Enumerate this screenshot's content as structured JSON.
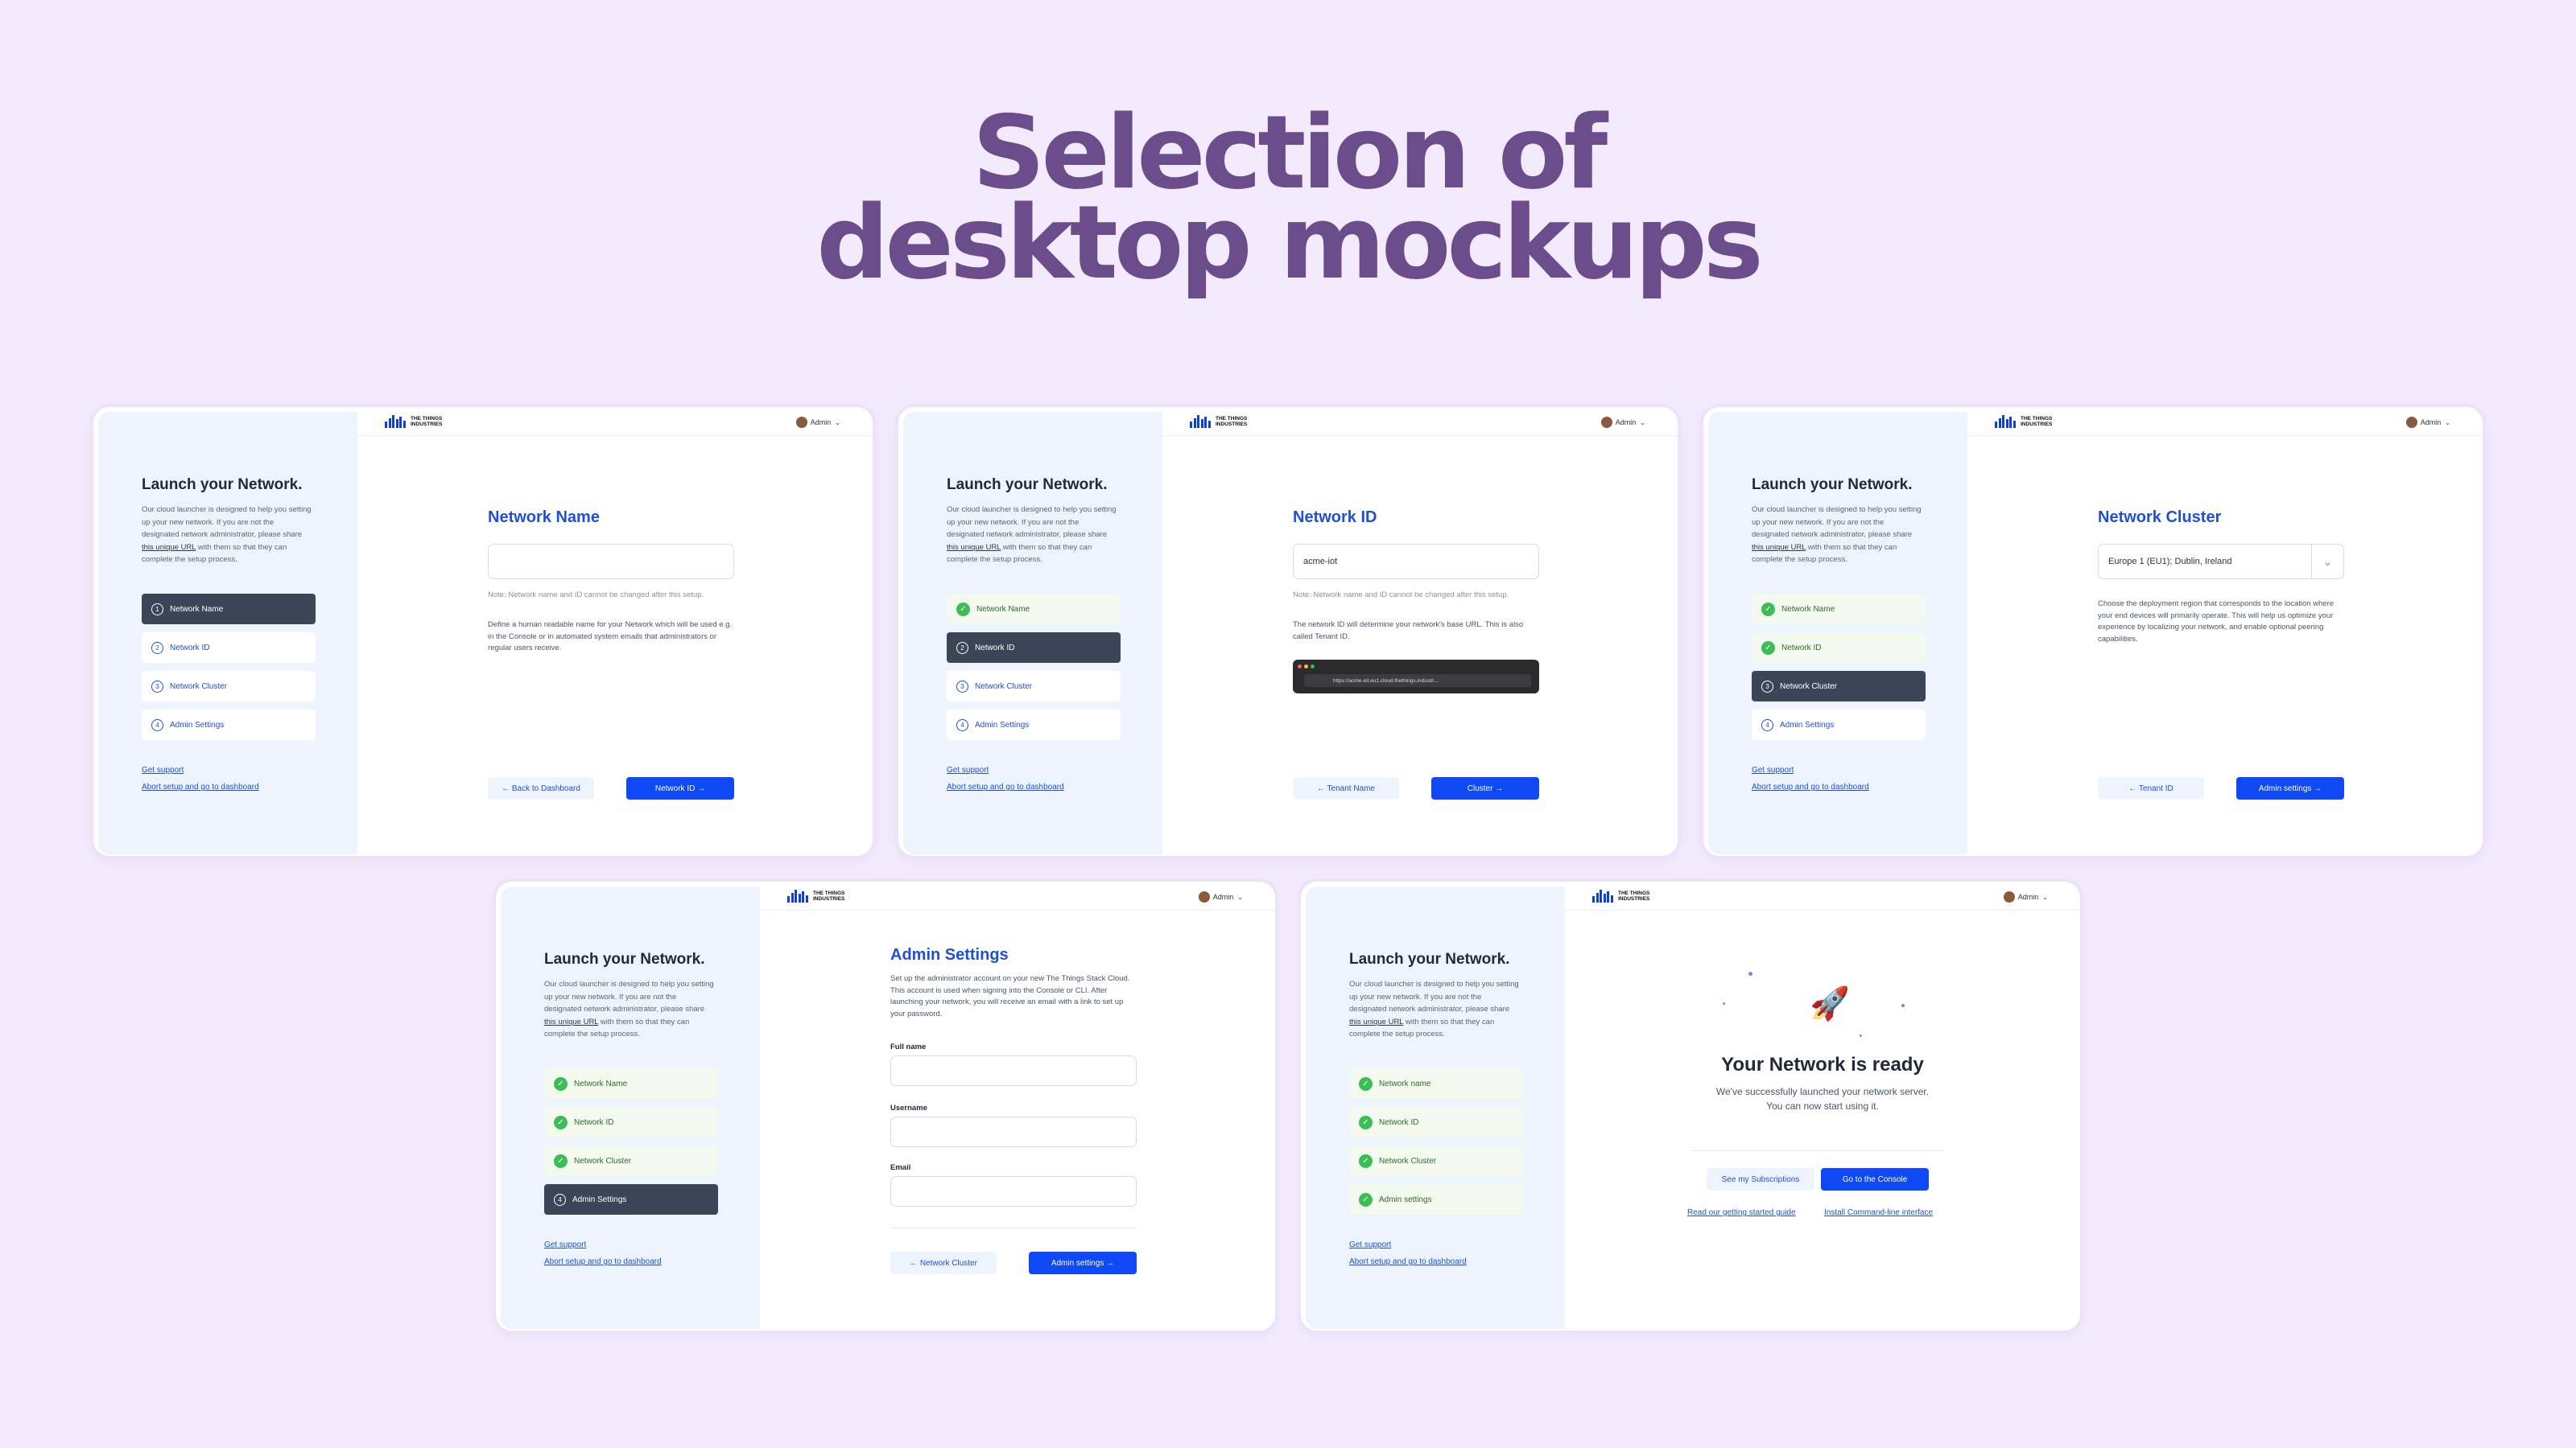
{
  "heading": {
    "line1": "Selection of",
    "line2": "desktop mockups"
  },
  "brand": {
    "logo_line1": "THE THINGS",
    "logo_line2": "INDUSTRIES",
    "user": "Admin"
  },
  "sidebar": {
    "title": "Launch your Network.",
    "desc_before": "Our cloud launcher is designed to help you setting up your new network. If you are not the designated network administrator, please share ",
    "desc_link": "this unique URL",
    "desc_after": " with them so that they can complete the setup process.",
    "support": "Get support",
    "abort": "Abort setup and go to dashboard"
  },
  "colors": {
    "background": "#f3ebfd",
    "heading": "#6b4d8c",
    "accent": "#0e49f5",
    "step_active": "#3a4558",
    "done": "#3dbd55"
  },
  "icons": {
    "done": "check-circle-icon",
    "rocket": "rocket-icon",
    "chevron": "chevron-down-icon"
  },
  "mocks": [
    {
      "steps": [
        {
          "n": "1",
          "label": "Network Name",
          "state": "active"
        },
        {
          "n": "2",
          "label": "Network ID",
          "state": "todo"
        },
        {
          "n": "3",
          "label": "Network Cluster",
          "state": "todo"
        },
        {
          "n": "4",
          "label": "Admin Settings",
          "state": "todo"
        }
      ],
      "title": "Network Name",
      "input_value": "",
      "note": "Note: Network name and ID cannot be changed after this setup.",
      "help": "Define a human readable name for your Network which will be used e.g. in the Console or in automated system emails that administrators or regular users receive.",
      "back": "← Back to Dashboard",
      "next": "Network ID →"
    },
    {
      "steps": [
        {
          "n": "1",
          "label": "Network Name",
          "state": "done"
        },
        {
          "n": "2",
          "label": "Network ID",
          "state": "active"
        },
        {
          "n": "3",
          "label": "Network Cluster",
          "state": "todo"
        },
        {
          "n": "4",
          "label": "Admin Settings",
          "state": "todo"
        }
      ],
      "title": "Network ID",
      "input_value": "acme-iot",
      "note": "Note: Network name and ID cannot be changed after this setup.",
      "help": "The network ID will determine your network's base URL. This is also called Tenant ID.",
      "browser_url": "https://acme-iot.eu1.cloud.thethings.industri...",
      "back": "← Tenant Name",
      "next": "Cluster →"
    },
    {
      "steps": [
        {
          "n": "1",
          "label": "Network Name",
          "state": "done"
        },
        {
          "n": "2",
          "label": "Network ID",
          "state": "done"
        },
        {
          "n": "3",
          "label": "Network Cluster",
          "state": "active"
        },
        {
          "n": "4",
          "label": "Admin Settings",
          "state": "todo"
        }
      ],
      "title": "Network Cluster",
      "select_value": "Europe 1 (EU1); Dublin, Ireland",
      "help": "Choose the deployment region that corresponds to the location where your end devices will primarily operate. This will help us optimize your experience by localizing your network, and enable optional peering capabilities.",
      "back": "← Tenant ID",
      "next": "Admin settings →"
    },
    {
      "steps": [
        {
          "n": "1",
          "label": "Network Name",
          "state": "done"
        },
        {
          "n": "2",
          "label": "Network ID",
          "state": "done"
        },
        {
          "n": "3",
          "label": "Network Cluster",
          "state": "done"
        },
        {
          "n": "4",
          "label": "Admin Settings",
          "state": "active"
        }
      ],
      "title": "Admin Settings",
      "help": "Set up the administrator account on your new The Things Stack Cloud. This account is used when signing into the Console or CLI. After launching your network, you will receive an email with a link to set up your password.",
      "fields": [
        "Full name",
        "Username",
        "Email"
      ],
      "back": "← Network Cluster",
      "next": "Admin settings →"
    },
    {
      "steps": [
        {
          "n": "1",
          "label": "Network name",
          "state": "done"
        },
        {
          "n": "2",
          "label": "Network ID",
          "state": "done"
        },
        {
          "n": "3",
          "label": "Network Cluster",
          "state": "done"
        },
        {
          "n": "4",
          "label": "Admin settings",
          "state": "done"
        }
      ],
      "ready_title": "Your Network is ready",
      "ready_sub1": "We've successfully launched your network server.",
      "ready_sub2": "You can now start using it.",
      "btn_subscriptions": "See my Subscriptions",
      "btn_console": "Go to the Console",
      "link_guide": "Read our getting started guide",
      "link_cli": "Install Command-line interface"
    }
  ]
}
